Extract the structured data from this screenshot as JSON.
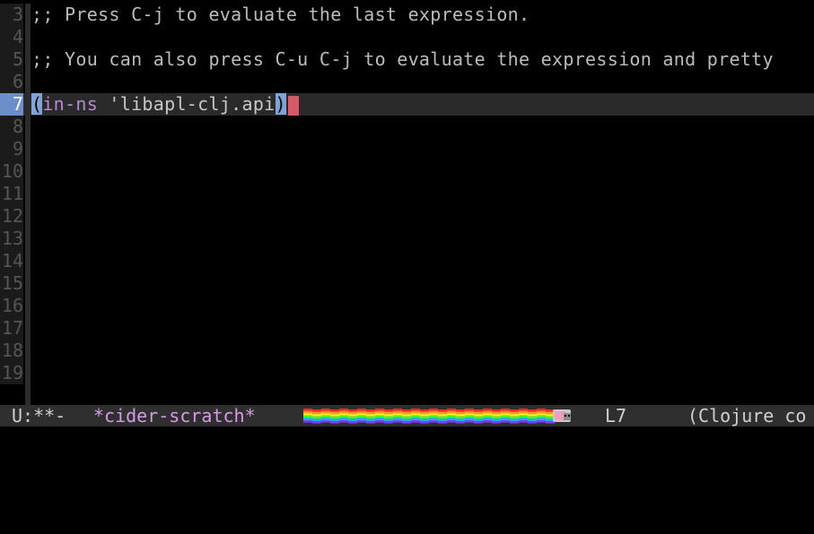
{
  "editor": {
    "lines": [
      {
        "num": "3",
        "text": ";; Press C-j to evaluate the last expression."
      },
      {
        "num": "4",
        "text": ""
      },
      {
        "num": "5",
        "text": ";; You can also press C-u C-j to evaluate the expression and pretty"
      },
      {
        "num": "6",
        "text": ""
      },
      {
        "num": "7",
        "open": "(",
        "keyword": "in-ns",
        "rest": " 'libapl-clj.api",
        "close": ")"
      },
      {
        "num": "8",
        "text": ""
      },
      {
        "num": "9",
        "text": ""
      },
      {
        "num": "10",
        "text": ""
      },
      {
        "num": "11",
        "text": ""
      },
      {
        "num": "12",
        "text": ""
      },
      {
        "num": "13",
        "text": ""
      },
      {
        "num": "14",
        "text": ""
      },
      {
        "num": "15",
        "text": ""
      },
      {
        "num": "16",
        "text": ""
      },
      {
        "num": "17",
        "text": ""
      },
      {
        "num": "18",
        "text": ""
      },
      {
        "num": "19",
        "text": ""
      }
    ]
  },
  "modeline": {
    "state": "U:**-",
    "buffer_name": "*cider-scratch*",
    "line": "L7",
    "mode": "(Clojure co"
  },
  "colors": {
    "background": "#000000",
    "current_line": "#2a2a2a",
    "current_gutter": "#6c8fcc",
    "cursor": "#d45a68",
    "keyword": "#b58cd1",
    "buffer_name": "#d59be6",
    "modeline_bg": "#2f2f2f"
  },
  "icons": {
    "nyan": "nyan-cat-progress-icon"
  }
}
